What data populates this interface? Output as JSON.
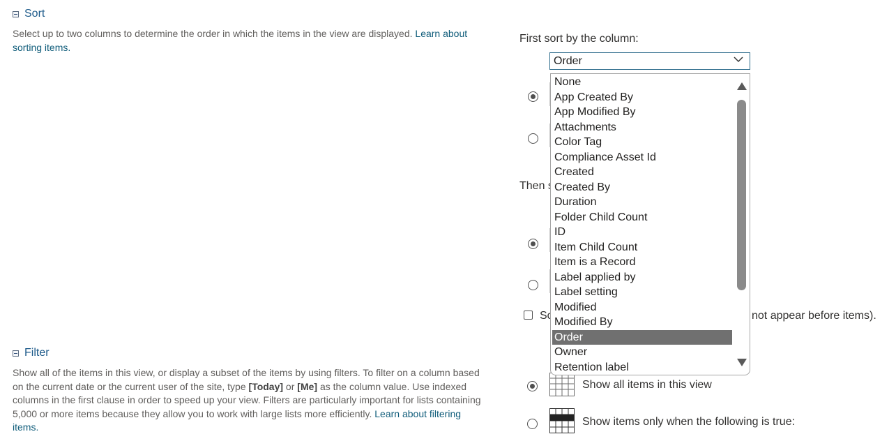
{
  "sort": {
    "title": "Sort",
    "desc_text": "Select up to two columns to determine the order in which the items in the view are displayed.",
    "desc_link_1": "Learn about",
    "desc_link_2": "sorting items.",
    "first_sort_label": "First sort by the column:",
    "selected_value": "Order",
    "then_partial": "Then s",
    "checkbox_partial_left": "So",
    "checkbox_partial_right": "not appear before items)."
  },
  "dropdown": {
    "options": [
      "None",
      "App Created By",
      "App Modified By",
      "Attachments",
      "Color Tag",
      "Compliance Asset Id",
      "Created",
      "Created By",
      "Duration",
      "Folder Child Count",
      "ID",
      "Item Child Count",
      "Item is a Record",
      "Label applied by",
      "Label setting",
      "Modified",
      "Modified By",
      "Order",
      "Owner",
      "Retention label"
    ],
    "selected_index": 17,
    "scroll_up_icon": "triangle-up-icon",
    "scroll_down_icon": "triangle-down-icon"
  },
  "filter": {
    "title": "Filter",
    "line1": "Show all of the items in this view, or display a subset of the items by using filters. To filter on a column based",
    "line2a": "on the current date or the current user of the site, type ",
    "today": "[Today]",
    "line2b": " or ",
    "me": "[Me]",
    "line2c": " as the column value. Use indexed",
    "line3": "columns in the first clause in order to speed up your view. Filters are particularly important for lists containing",
    "line4": "5,000 or more items because they allow you to work with large lists more efficiently.",
    "link_1": "Learn about filtering",
    "link_2": "items.",
    "option_all": "Show all items in this view",
    "option_conditional": "Show items only when the following is true:"
  },
  "colors": {
    "accent": "#1d5a8a",
    "link": "#0f5c7a",
    "selected_bg": "#707070",
    "scrollbar": "#8a8a8a"
  }
}
